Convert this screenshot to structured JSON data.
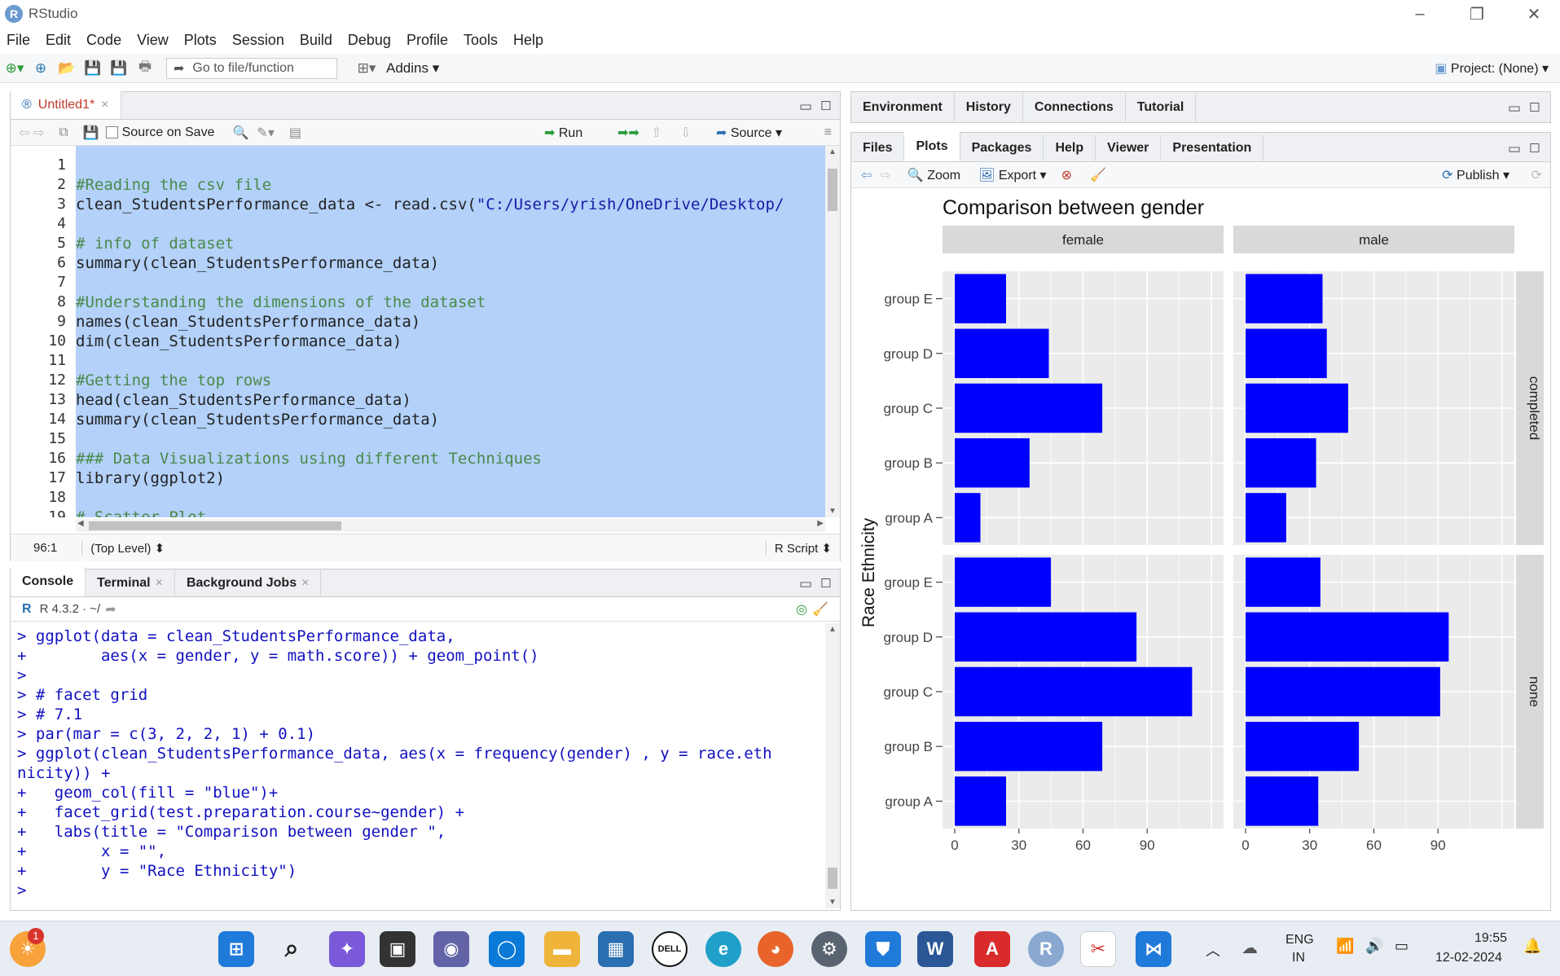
{
  "window": {
    "title": "RStudio"
  },
  "menu": [
    "File",
    "Edit",
    "Code",
    "View",
    "Plots",
    "Session",
    "Build",
    "Debug",
    "Profile",
    "Tools",
    "Help"
  ],
  "toolbar": {
    "goto_placeholder": "Go to file/function",
    "addins": "Addins",
    "project": "Project: (None)"
  },
  "editor": {
    "tab": "Untitled1*",
    "source_on_save": "Source on Save",
    "run": "Run",
    "source": "Source",
    "status_pos": "96:1",
    "status_level": "(Top Level)",
    "status_type": "R Script",
    "lines": [
      "",
      "#Reading the csv file",
      "clean_StudentsPerformance_data <- read.csv(\"C:/Users/yrish/OneDrive/Desktop/",
      "",
      "# info of dataset",
      "summary(clean_StudentsPerformance_data)",
      "",
      "#Understanding the dimensions of the dataset",
      "names(clean_StudentsPerformance_data)",
      "dim(clean_StudentsPerformance_data)",
      "",
      "#Getting the top rows",
      "head(clean_StudentsPerformance_data)",
      "summary(clean_StudentsPerformance_data)",
      "",
      "### Data Visualizations using different Techniques",
      "library(ggplot2)",
      "",
      "# Scatter Plot",
      ""
    ]
  },
  "console": {
    "tabs": [
      "Console",
      "Terminal",
      "Background Jobs"
    ],
    "version": "R 4.3.2 · ~/",
    "lines": [
      "> ggplot(data = clean_StudentsPerformance_data,",
      "+        aes(x = gender, y = math.score)) + geom_point()",
      ">",
      "> # facet grid",
      "> # 7.1",
      "> par(mar = c(3, 2, 2, 1) + 0.1)",
      "> ggplot(clean_StudentsPerformance_data, aes(x = frequency(gender) , y = race.eth",
      "nicity)) +",
      "+   geom_col(fill = \"blue\")+",
      "+   facet_grid(test.preparation.course~gender) +",
      "+   labs(title = \"Comparison between gender \",",
      "+        x = \"\",",
      "+        y = \"Race Ethnicity\")",
      "> "
    ]
  },
  "env_tabs": [
    "Environment",
    "History",
    "Connections",
    "Tutorial"
  ],
  "files_tabs": [
    "Files",
    "Plots",
    "Packages",
    "Help",
    "Viewer",
    "Presentation"
  ],
  "plot_toolbar": {
    "zoom": "Zoom",
    "export": "Export",
    "publish": "Publish"
  },
  "chart_data": {
    "type": "bar",
    "title": "Comparison between gender",
    "xlabel": "",
    "ylabel": "Race Ethnicity",
    "facets_col": [
      "female",
      "male"
    ],
    "facets_row": [
      "completed",
      "none"
    ],
    "categories": [
      "group E",
      "group D",
      "group C",
      "group B",
      "group A"
    ],
    "xticks": [
      0,
      30,
      60,
      90
    ],
    "xlim": [
      0,
      120
    ],
    "fill": "#0000ff",
    "panels": [
      {
        "row": "completed",
        "col": "female",
        "values": [
          24,
          44,
          69,
          35,
          12
        ]
      },
      {
        "row": "completed",
        "col": "male",
        "values": [
          36,
          38,
          48,
          33,
          19
        ]
      },
      {
        "row": "none",
        "col": "female",
        "values": [
          45,
          85,
          111,
          69,
          24
        ]
      },
      {
        "row": "none",
        "col": "male",
        "values": [
          35,
          95,
          91,
          53,
          34
        ]
      }
    ]
  },
  "taskbar": {
    "lang1": "ENG",
    "lang2": "IN",
    "time": "19:55",
    "date": "12-02-2024",
    "badge": "1"
  },
  "colors": {
    "selection": "#b3d1f9",
    "bar": "#0000ff",
    "panel_bg": "#ebebeb"
  }
}
